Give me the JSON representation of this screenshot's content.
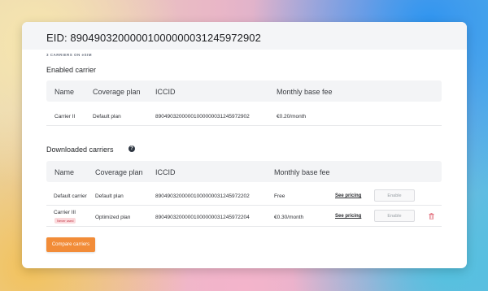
{
  "eid_title": "EID: 89049032000001000000031245972902",
  "eyebrow": "3 CARRIERS ON eSIM",
  "enabled": {
    "title": "Enabled carrier",
    "columns": {
      "name": "Name",
      "coverage": "Coverage plan",
      "iccid": "ICCID",
      "fee": "Monthly base fee"
    },
    "rows": [
      {
        "name": "Carrier II",
        "plan": "Default plan",
        "iccid": "89049032000001000000031245972902",
        "fee": "€0.20/month"
      }
    ]
  },
  "downloaded": {
    "title": "Downloaded carriers",
    "help_glyph": "?",
    "columns": {
      "name": "Name",
      "coverage": "Coverage plan",
      "iccid": "ICCID",
      "fee": "Monthly base fee"
    },
    "rows": [
      {
        "name": "Default carrier",
        "plan": "Default plan",
        "iccid": "89049032000001000000031245972202",
        "fee": "Free",
        "pricing": "See pricing",
        "enable": "Enable"
      },
      {
        "name": "Carrier III",
        "badge": "Never used",
        "plan": "Optimized plan",
        "iccid": "89049032000001000000031245972204",
        "fee": "€0.30/month",
        "pricing": "See pricing",
        "enable": "Enable"
      }
    ]
  },
  "compare_button": "Compare carriers",
  "colors": {
    "accent": "#f28c38",
    "badge_bg": "#fbd9dc",
    "badge_text": "#c23a48",
    "trash": "#e06673"
  }
}
